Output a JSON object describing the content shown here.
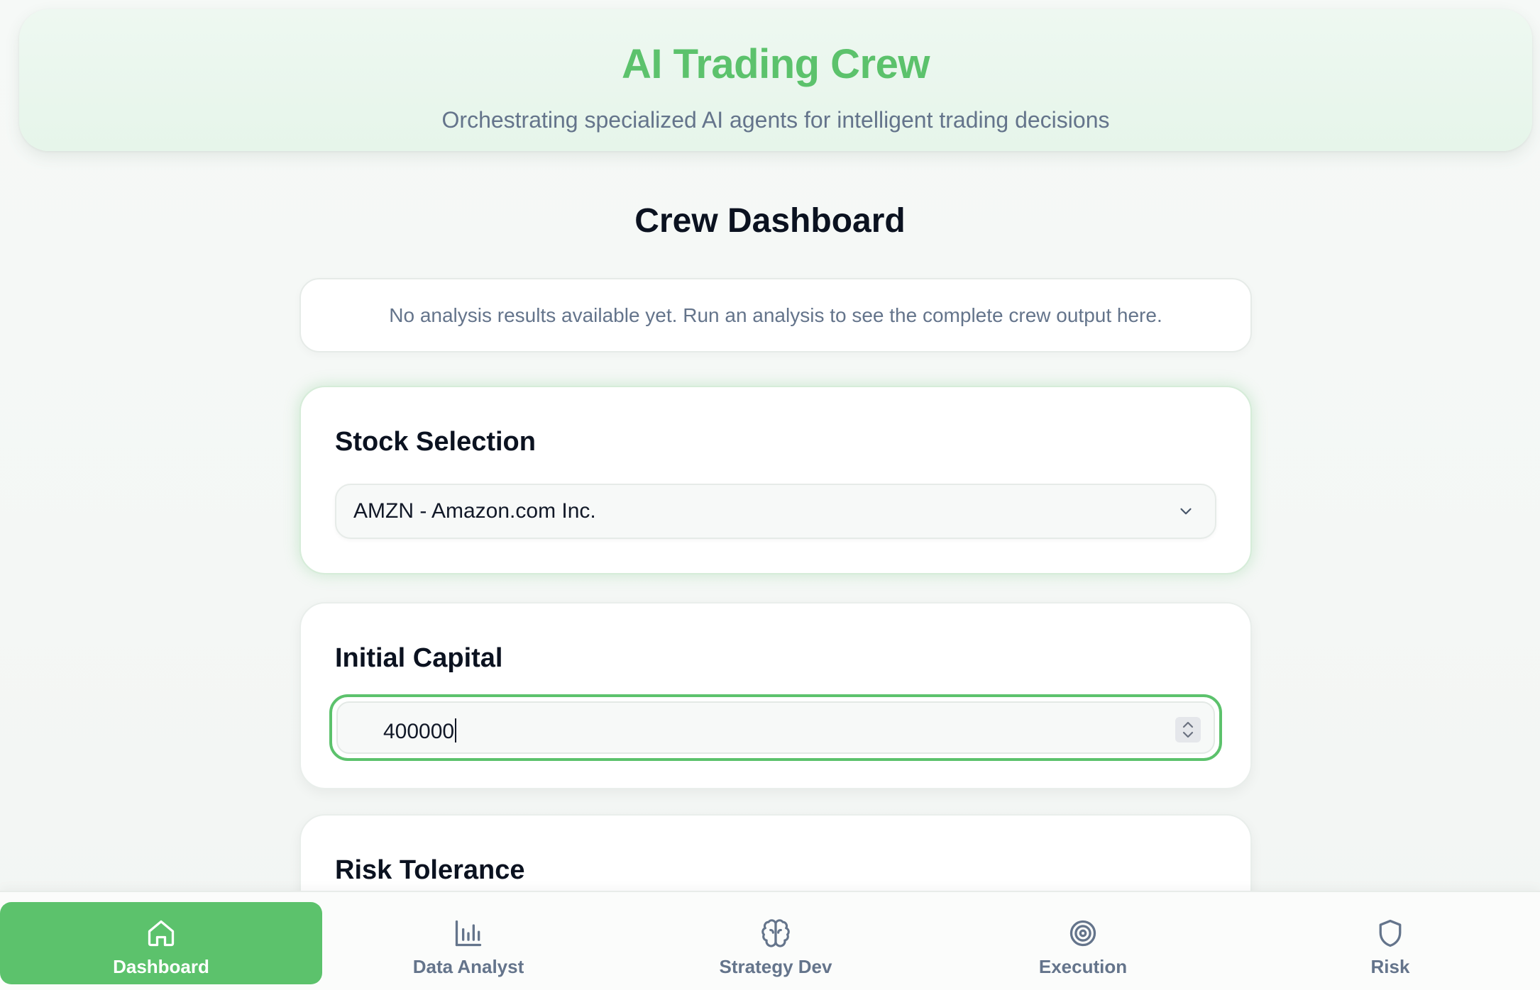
{
  "header": {
    "title": "AI Trading Crew",
    "subtitle": "Orchestrating specialized AI agents for intelligent trading decisions"
  },
  "main": {
    "title": "Crew Dashboard",
    "info_message": "No analysis results available yet. Run an analysis to see the complete crew output here."
  },
  "stock_selection": {
    "label": "Stock Selection",
    "selected": "AMZN - Amazon.com Inc."
  },
  "initial_capital": {
    "label": "Initial Capital",
    "value": "400000"
  },
  "risk_tolerance": {
    "label": "Risk Tolerance"
  },
  "nav": {
    "items": [
      {
        "label": "Dashboard",
        "icon": "home-icon",
        "active": true
      },
      {
        "label": "Data Analyst",
        "icon": "bar-chart-icon",
        "active": false
      },
      {
        "label": "Strategy Dev",
        "icon": "brain-icon",
        "active": false
      },
      {
        "label": "Execution",
        "icon": "target-icon",
        "active": false
      },
      {
        "label": "Risk",
        "icon": "shield-icon",
        "active": false
      }
    ]
  },
  "colors": {
    "accent": "#5cc26c",
    "muted_text": "#64748b",
    "header_bg": "#e9f7ed"
  }
}
